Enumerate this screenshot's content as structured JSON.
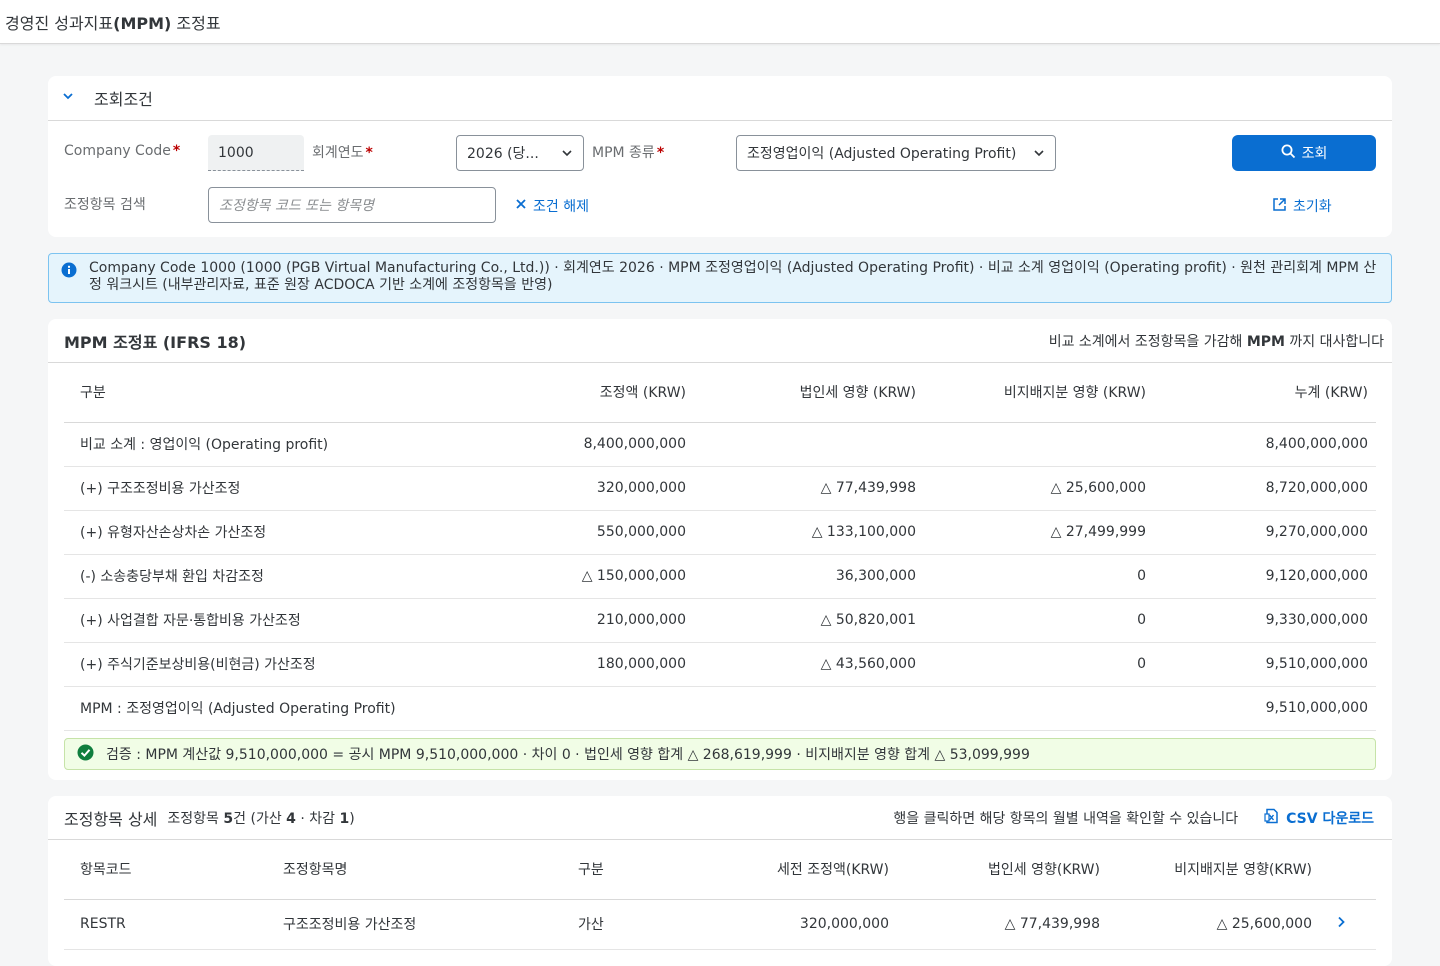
{
  "shell": {
    "title_prefix": "경영진 성과지표",
    "title_bold": "(MPM)",
    "title_suffix": " 조정표"
  },
  "filter": {
    "header": "조회조건",
    "company_code_label": "Company Code",
    "company_code_value": "1000",
    "fiscal_year_label": "회계연도",
    "fiscal_year_value": "2026 (당...",
    "mpm_type_label": "MPM 종류",
    "mpm_type_value": "조정영업이익 (Adjusted Operating Profit)",
    "search_label": "조정항목 검색",
    "search_placeholder": "조정항목 코드 또는 항목명",
    "clear_label": "조건 해제",
    "query_label": "조회",
    "reset_label": "초기화",
    "required_mark": "*"
  },
  "info": {
    "text": "Company Code 1000 (1000 (PGB Virtual Manufacturing Co., Ltd.)) · 회계연도 2026 · MPM 조정영업이익 (Adjusted Operating Profit) · 비교 소계 영업이익 (Operating profit) · 원천 관리회계 MPM 산정 워크시트 (내부관리자료, 표준 원장 ACDOCA 기반 소계에 조정항목을 반영)"
  },
  "mpm": {
    "title": "MPM 조정표 (IFRS 18)",
    "subtitle_a": "비교 소계에서 조정항목을 가감해 ",
    "subtitle_b": "MPM",
    "subtitle_c": " 까지 대사합니다",
    "columns": [
      "구분",
      "조정액 (KRW)",
      "법인세 영향 (KRW)",
      "비지배지분 영향 (KRW)",
      "누계 (KRW)"
    ],
    "rows": [
      [
        "비교 소계 : 영업이익 (Operating profit)",
        "8,400,000,000",
        "",
        "",
        "8,400,000,000"
      ],
      [
        "(+) 구조조정비용 가산조정",
        "320,000,000",
        "△ 77,439,998",
        "△ 25,600,000",
        "8,720,000,000"
      ],
      [
        "(+) 유형자산손상차손 가산조정",
        "550,000,000",
        "△ 133,100,000",
        "△ 27,499,999",
        "9,270,000,000"
      ],
      [
        "(-) 소송충당부채 환입 차감조정",
        "△ 150,000,000",
        "36,300,000",
        "0",
        "9,120,000,000"
      ],
      [
        "(+) 사업결합 자문·통합비용 가산조정",
        "210,000,000",
        "△ 50,820,001",
        "0",
        "9,330,000,000"
      ],
      [
        "(+) 주식기준보상비용(비현금) 가산조정",
        "180,000,000",
        "△ 43,560,000",
        "0",
        "9,510,000,000"
      ],
      [
        "MPM : 조정영업이익 (Adjusted Operating Profit)",
        "",
        "",
        "",
        "9,510,000,000"
      ]
    ],
    "verify": "검증 : MPM 계산값 9,510,000,000 = 공시 MPM 9,510,000,000 · 차이 0 · 법인세 영향 합계 △ 268,619,999 · 비지배지분 영향 합계 △ 53,099,999"
  },
  "detail": {
    "title": "조정항목 상세",
    "count_a": "조정항목 ",
    "count_b": "5",
    "count_c": "건 (",
    "count_d": "가산 ",
    "count_e": "4",
    "count_f": " · ",
    "count_g": "차감 ",
    "count_h": "1",
    "count_i": ")",
    "hint": "행을 클릭하면 해당 항목의 월별 내역을 확인할 수 있습니다",
    "csv": "CSV 다운로드",
    "columns": [
      "항목코드",
      "조정항목명",
      "구분",
      "세전 조정액(KRW)",
      "법인세 영향(KRW)",
      "비지배지분 영향(KRW)"
    ],
    "rows": [
      [
        "RESTR",
        "구조조정비용 가산조정",
        "가산",
        "320,000,000",
        "△ 77,439,998",
        "△ 25,600,000"
      ]
    ]
  },
  "colors": {
    "accent": "#0a6ed1",
    "positive": "#107e3e",
    "required": "#bb0000"
  }
}
